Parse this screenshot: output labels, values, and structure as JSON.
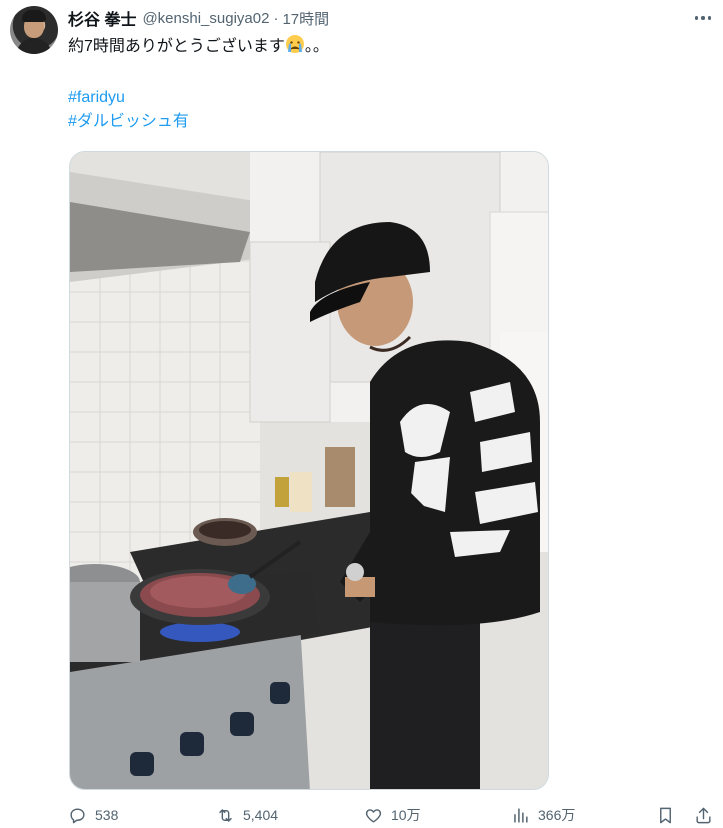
{
  "tweet": {
    "display_name": "杉谷 拳士",
    "handle": "@kenshi_sugiya02",
    "separator": "·",
    "time": "17時間",
    "text": "約7時間ありがとうございます",
    "text_suffix": "。。",
    "emoji": "crying-face",
    "hashtags": [
      "#faridyu",
      "#ダルビッシュ有"
    ]
  },
  "media": {
    "description_icon": "photo"
  },
  "actions": {
    "replies": "538",
    "retweets": "5,404",
    "likes": "10万",
    "views": "366万"
  },
  "colors": {
    "text": "#0f1419",
    "secondary": "#536471",
    "link": "#1d9bf0",
    "border": "#cfd9de"
  }
}
